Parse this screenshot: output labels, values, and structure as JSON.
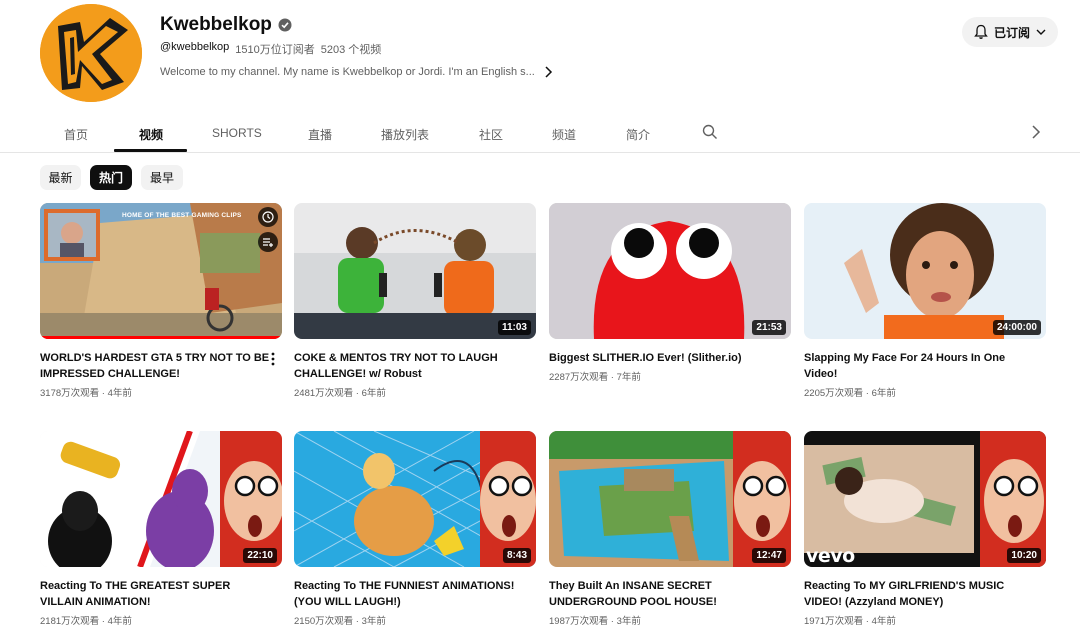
{
  "channel": {
    "name": "Kwebbelkop",
    "handle": "@kwebbelkop",
    "subscribers": "1510万位订阅者",
    "video_count": "5203 个视频",
    "description": "Welcome to my channel. My name is Kwebbelkop or Jordi. I'm an English s...",
    "subscribe_label": "已订阅",
    "brand_color": "#f39c1b"
  },
  "tabs": [
    {
      "label": "首页"
    },
    {
      "label": "视频"
    },
    {
      "label": "SHORTS"
    },
    {
      "label": "直播"
    },
    {
      "label": "播放列表"
    },
    {
      "label": "社区"
    },
    {
      "label": "频道"
    },
    {
      "label": "简介"
    }
  ],
  "active_tab": "视频",
  "chips": [
    "最新",
    "热门",
    "最早"
  ],
  "active_chip": "热门",
  "videos": [
    {
      "title": "WORLD'S HARDEST GTA 5 TRY NOT TO BE IMPRESSED CHALLENGE!",
      "views": "3178万次观看",
      "age": "4年前",
      "duration": "",
      "overlay_text": "HOME OF THE BEST GAMING CLIPS"
    },
    {
      "title": "COKE & MENTOS TRY NOT TO LAUGH CHALLENGE! w/ Robust",
      "views": "2481万次观看",
      "age": "6年前",
      "duration": "11:03"
    },
    {
      "title": "Biggest SLITHER.IO Ever! (Slither.io)",
      "views": "2287万次观看",
      "age": "7年前",
      "duration": "21:53"
    },
    {
      "title": "Slapping My Face For 24 Hours In One Video!",
      "views": "2205万次观看",
      "age": "6年前",
      "duration": "24:00:00"
    },
    {
      "title": "Reacting To THE GREATEST SUPER VILLAIN ANIMATION!",
      "views": "2181万次观看",
      "age": "4年前",
      "duration": "22:10"
    },
    {
      "title": "Reacting To THE FUNNIEST ANIMATIONS! (YOU WILL LAUGH!)",
      "views": "2150万次观看",
      "age": "3年前",
      "duration": "8:43"
    },
    {
      "title": "They Built An INSANE SECRET UNDERGROUND POOL HOUSE!",
      "views": "1987万次观看",
      "age": "3年前",
      "duration": "12:47"
    },
    {
      "title": "Reacting To MY GIRLFRIEND'S MUSIC VIDEO! (Azzyland MONEY)",
      "views": "1971万次观看",
      "age": "4年前",
      "duration": "10:20",
      "watermark": "vevo"
    }
  ],
  "meta_separator": "·"
}
